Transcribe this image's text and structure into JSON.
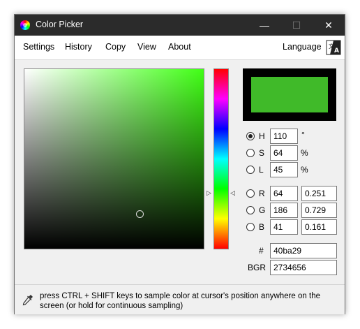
{
  "window": {
    "title": "Color Picker",
    "minimize": "—",
    "maximize": "☐",
    "close": "✕"
  },
  "menu": {
    "items": [
      "Settings",
      "History",
      "Copy",
      "View",
      "About"
    ],
    "language": "Language"
  },
  "colors": {
    "current": "#40ba29",
    "hue_pure": "#40ff15"
  },
  "hsl": {
    "h": {
      "label": "H",
      "value": "110",
      "unit": "°",
      "selected": true
    },
    "s": {
      "label": "S",
      "value": "64",
      "unit": "%",
      "selected": false
    },
    "l": {
      "label": "L",
      "value": "45",
      "unit": "%",
      "selected": false
    }
  },
  "rgb": {
    "r": {
      "label": "R",
      "value": "64",
      "fraction": "0.251"
    },
    "g": {
      "label": "G",
      "value": "186",
      "fraction": "0.729"
    },
    "b": {
      "label": "B",
      "value": "41",
      "fraction": "0.161"
    }
  },
  "hex": {
    "label": "#",
    "value": "40ba29"
  },
  "bgr": {
    "label": "BGR",
    "value": "2734656"
  },
  "status": {
    "text": "press CTRL + SHIFT keys to sample color at cursor's position anywhere on the screen (or hold for continuous sampling)"
  }
}
